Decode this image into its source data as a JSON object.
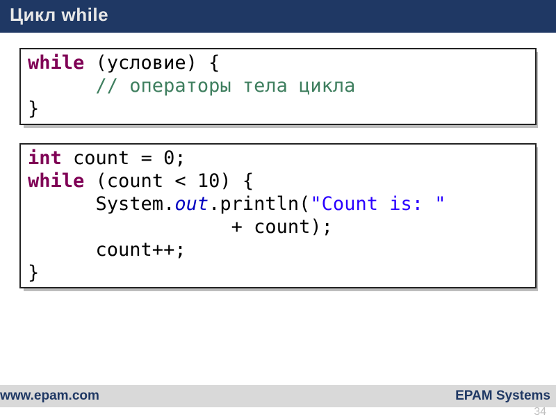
{
  "header": {
    "title": "Цикл while"
  },
  "code1": {
    "kw_while": "while",
    "cond": " (условие) {",
    "comment": "      // операторы тела цикла",
    "close": "}"
  },
  "code2": {
    "ty_int": "int",
    "decl_rest": " count = 0;",
    "kw_while": "while",
    "cond": " (count < 10) {",
    "indent1": "      System.",
    "out": "out",
    "println_open": ".println(",
    "str": "\"Count is: \"",
    "line_cont": "                  + count);",
    "incr": "      count++;",
    "close": "}"
  },
  "footer": {
    "left": "www.epam.com",
    "right": "EPAM Systems",
    "page": "34"
  }
}
